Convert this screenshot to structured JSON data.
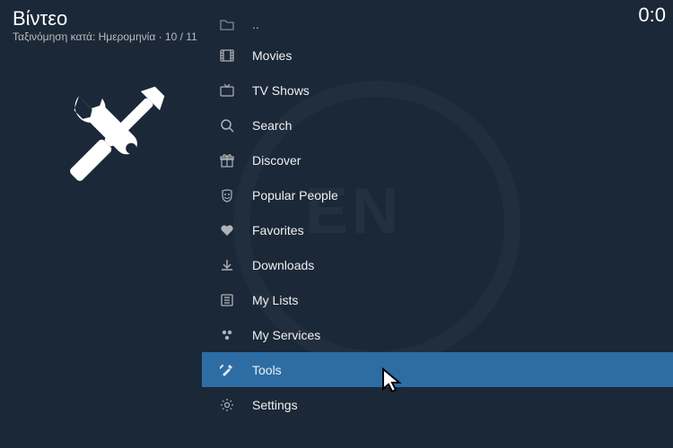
{
  "header": {
    "title": "Βίντεο",
    "subtitle": "Ταξινόμηση κατά: Ημερομηνία  ·  10 / 11"
  },
  "clock": "0:0",
  "parent_marker": "..",
  "menu": [
    {
      "id": "movies",
      "label": "Movies",
      "icon": "film"
    },
    {
      "id": "tvshows",
      "label": "TV Shows",
      "icon": "tv"
    },
    {
      "id": "search",
      "label": "Search",
      "icon": "search"
    },
    {
      "id": "discover",
      "label": "Discover",
      "icon": "gift"
    },
    {
      "id": "popular-people",
      "label": "Popular People",
      "icon": "mask"
    },
    {
      "id": "favorites",
      "label": "Favorites",
      "icon": "heart"
    },
    {
      "id": "downloads",
      "label": "Downloads",
      "icon": "download"
    },
    {
      "id": "my-lists",
      "label": "My Lists",
      "icon": "list"
    },
    {
      "id": "my-services",
      "label": "My Services",
      "icon": "services"
    },
    {
      "id": "tools",
      "label": "Tools",
      "icon": "tools",
      "selected": true
    },
    {
      "id": "settings",
      "label": "Settings",
      "icon": "gear"
    }
  ]
}
